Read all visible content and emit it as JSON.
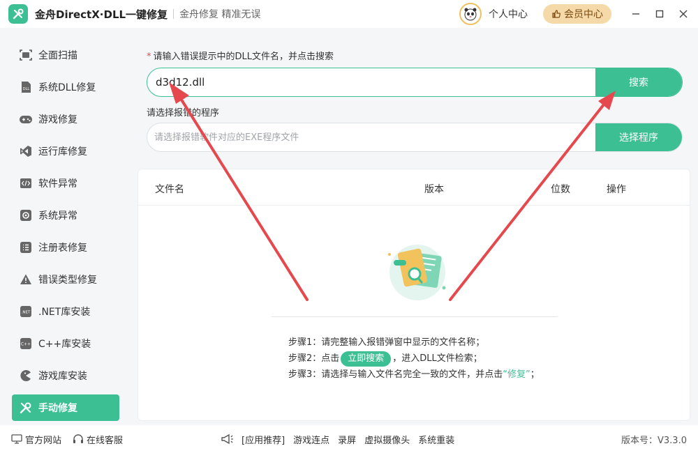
{
  "app": {
    "title": "金舟DirectX·DLL一键修复",
    "slogan": "金舟修复 精准无误",
    "user_center": "个人中心",
    "vip_center": "会员中心"
  },
  "sidebar": {
    "items": [
      {
        "label": "全面扫描",
        "icon": "scan-icon"
      },
      {
        "label": "系统DLL修复",
        "icon": "dll-icon"
      },
      {
        "label": "游戏修复",
        "icon": "gamepad-icon"
      },
      {
        "label": "运行库修复",
        "icon": "vs-icon"
      },
      {
        "label": "软件异常",
        "icon": "code-icon"
      },
      {
        "label": "系统异常",
        "icon": "gear-icon"
      },
      {
        "label": "注册表修复",
        "icon": "list-icon"
      },
      {
        "label": "错误类型修复",
        "icon": "warning-icon"
      },
      {
        "label": ".NET库安装",
        "icon": "net-icon"
      },
      {
        "label": "C++库安装",
        "icon": "cpp-icon"
      },
      {
        "label": "游戏库安装",
        "icon": "pacman-icon"
      },
      {
        "label": "手动修复",
        "icon": "wrench-icon",
        "active": true
      }
    ]
  },
  "main": {
    "search_label_star": "*",
    "search_label": "请输入错误提示中的DLL文件名，并点击搜索",
    "search_value": "d3d12.dll",
    "search_button": "搜索",
    "program_label": "请选择报错的程序",
    "program_placeholder": "请选择报错软件对应的EXE程序文件",
    "program_button": "选择程序",
    "table_headers": {
      "file": "文件名",
      "version": "版本",
      "bits": "位数",
      "action": "操作"
    },
    "steps": {
      "step1": "步骤1：请完整输入报错弹窗中显示的文件名称；",
      "step2_pre": "步骤2：点击",
      "step2_btn": "立即搜索",
      "step2_post": "，进入DLL文件检索；",
      "step3_pre": "步骤3：请选择与输入文件名完全一致的文件，并点击",
      "step3_hl": "“修复”",
      "step3_post": "；"
    }
  },
  "footer": {
    "website": "官方网站",
    "service": "在线客服",
    "recommend": "[应用推荐]",
    "links": [
      "游戏连点",
      "录屏",
      "虚拟摄像头",
      "系统重装"
    ],
    "version": "版本号：V3.3.0"
  },
  "colors": {
    "accent": "#3dbf94",
    "arrow": "#e5484d",
    "vip_bg": "#f5d9a8"
  }
}
